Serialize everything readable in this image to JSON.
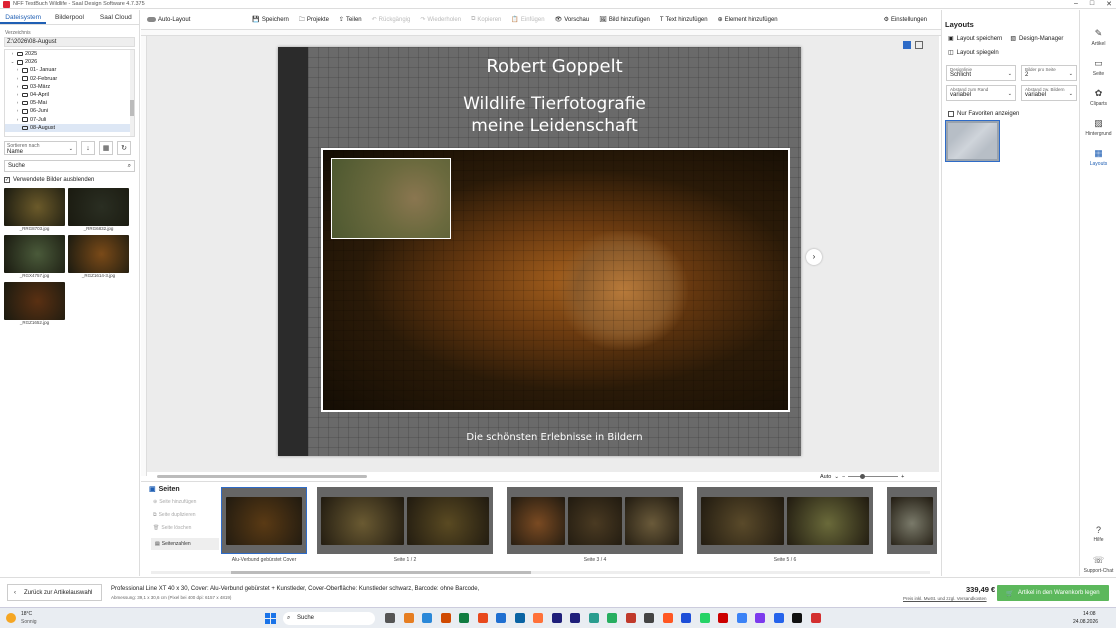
{
  "window": {
    "title": "NFF TestBuch Wildlife - Saal Design Software 4.7.375"
  },
  "left": {
    "tabs": [
      "Dateisystem",
      "Bilderpool",
      "Saal Cloud"
    ],
    "dir_label": "Verzeichnis",
    "dir_path": "Z:\\2026\\08-August",
    "tree": [
      {
        "label": "2025",
        "indent": 1,
        "chev": "›"
      },
      {
        "label": "2026",
        "indent": 1,
        "chev": "⌄"
      },
      {
        "label": "01- Januar",
        "indent": 2,
        "chev": "›"
      },
      {
        "label": "02-Februar",
        "indent": 2,
        "chev": "›"
      },
      {
        "label": "03-März",
        "indent": 2,
        "chev": "›"
      },
      {
        "label": "04-April",
        "indent": 2,
        "chev": "›"
      },
      {
        "label": "05-Mai",
        "indent": 2,
        "chev": "›"
      },
      {
        "label": "06-Juni",
        "indent": 2,
        "chev": "›"
      },
      {
        "label": "07-Juli",
        "indent": 2,
        "chev": "›"
      },
      {
        "label": "08-August",
        "indent": 2,
        "chev": "",
        "selected": true
      }
    ],
    "sort_label": "Sortieren nach",
    "sort_value": "Name",
    "search_placeholder": "Suche",
    "hide_used_label": "Verwendete Bilder ausblenden",
    "thumbs": [
      {
        "name": "_RRG8703.jpg",
        "color": "#6b5a2a"
      },
      {
        "name": "_RRG6832.jpg",
        "color": "#2a2e22"
      },
      {
        "name": "_RGX4757.jpg",
        "color": "#4a5a3a"
      },
      {
        "name": "_RGZ1614-3.jpg",
        "color": "#7a4a18"
      },
      {
        "name": "_RGZ1652.jpg",
        "color": "#5a3012"
      }
    ]
  },
  "toolbar": {
    "auto_layout": "Auto-Layout",
    "items": [
      {
        "label": "Speichern",
        "enabled": true
      },
      {
        "label": "Projekte",
        "enabled": true
      },
      {
        "label": "Teilen",
        "enabled": true
      },
      {
        "label": "Rückgängig",
        "enabled": false
      },
      {
        "label": "Wiederholen",
        "enabled": false
      },
      {
        "label": "Kopieren",
        "enabled": false
      },
      {
        "label": "Einfügen",
        "enabled": false
      },
      {
        "label": "Vorschau",
        "enabled": true
      },
      {
        "label": "Bild hinzufügen",
        "enabled": true
      },
      {
        "label": "Text hinzufügen",
        "enabled": true
      },
      {
        "label": "Element hinzufügen",
        "enabled": true
      }
    ],
    "settings": "Einstellungen"
  },
  "cover": {
    "author": "Robert Goppelt",
    "title_line1": "Wildlife Tierfotografie",
    "title_line2": "meine Leidenschaft",
    "subtitle": "Die schönsten Erlebnisse in Bildern"
  },
  "zoom": {
    "label": "Auto"
  },
  "pages": {
    "heading": "Seiten",
    "buttons": [
      "Seite hinzufügen",
      "Seite duplizieren",
      "Seite löschen"
    ],
    "numbers_button": "Seitenzahlen",
    "thumbs": [
      {
        "label": "Alu-Verbund gebürstet Cover",
        "colors": [
          "#5a3a14"
        ]
      },
      {
        "label": "Seite 1 / 2",
        "colors": [
          "#6a5a32",
          "#5a4a22"
        ]
      },
      {
        "label": "Seite 3 / 4",
        "colors": [
          "#7a4a22",
          "#4a3a22",
          "#6a5a3a"
        ]
      },
      {
        "label": "Seite 5 / 6",
        "colors": [
          "#5a4a2a",
          "#6a6a3a"
        ]
      },
      {
        "label": "",
        "colors": [
          "#7a7a6a"
        ]
      }
    ]
  },
  "right": {
    "title": "Layouts",
    "save_layout": "Layout speichern",
    "design_manager": "Design-Manager",
    "mirror_layout": "Layout spiegeln",
    "selects": [
      {
        "label": "Designlinie",
        "value": "Schlicht"
      },
      {
        "label": "Bilder pro Seite",
        "value": "2"
      },
      {
        "label": "Abstand zum Rand",
        "value": "variabel"
      },
      {
        "label": "Abstand zw. Bildern",
        "value": "variabel"
      }
    ],
    "favorites_only": "Nur Favoriten anzeigen"
  },
  "rail": [
    {
      "label": "Artikel",
      "glyph": "✎"
    },
    {
      "label": "Seite",
      "glyph": "▭"
    },
    {
      "label": "Cliparts",
      "glyph": "✿"
    },
    {
      "label": "Hintergrund",
      "glyph": "▨"
    },
    {
      "label": "Layouts",
      "glyph": "▦",
      "active": true
    },
    {
      "label": "Hilfe",
      "glyph": "?"
    },
    {
      "label": "Support-Chat",
      "glyph": "☏"
    }
  ],
  "bottom": {
    "back": "Zurück zur Artikelauswahl",
    "product": "Professional Line XT 40 x 30, Cover: Alu-Verbund gebürstet + Kunstleder, Cover-Oberfläche: Kunstleder schwarz, Barcode: ohne Barcode,",
    "dims": "Abmessung: 39,1 x 30,6 cm (Pixel bei 400 dpi: 6157 x 4819)",
    "price": "339,49 €",
    "price_note": "Preis inkl. MwSt. und zzgl. Versandkosten",
    "cart": "Artikel in den Warenkorb legen"
  },
  "taskbar": {
    "temp": "18°C",
    "weather": "Sonnig",
    "search": "Suche",
    "time": "14:08",
    "date": "24.08.2026"
  }
}
